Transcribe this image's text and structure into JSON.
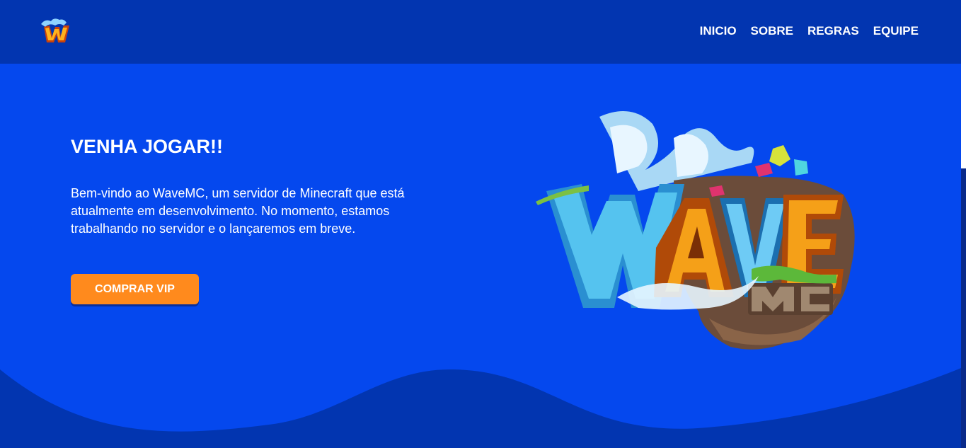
{
  "nav": {
    "logo_icon": "wavemc-logo-icon",
    "links": [
      {
        "label": "INICIO"
      },
      {
        "label": "SOBRE"
      },
      {
        "label": "REGRAS"
      },
      {
        "label": "EQUIPE"
      }
    ]
  },
  "hero": {
    "title": "VENHA JOGAR!!",
    "text": "Bem-vindo ao WaveMC, um servidor de Minecraft que está atualmente em desenvolvimento. No momento, estamos trabalhando no servidor e o lançaremos em breve.",
    "button_label": "COMPRAR VIP",
    "art_text": "WAVE",
    "art_subtext": "MC"
  },
  "colors": {
    "nav_bg": "#0235B0",
    "hero_bg": "#0548EE",
    "wave_bg": "#0235B0",
    "button_bg": "#FF8A1D"
  }
}
